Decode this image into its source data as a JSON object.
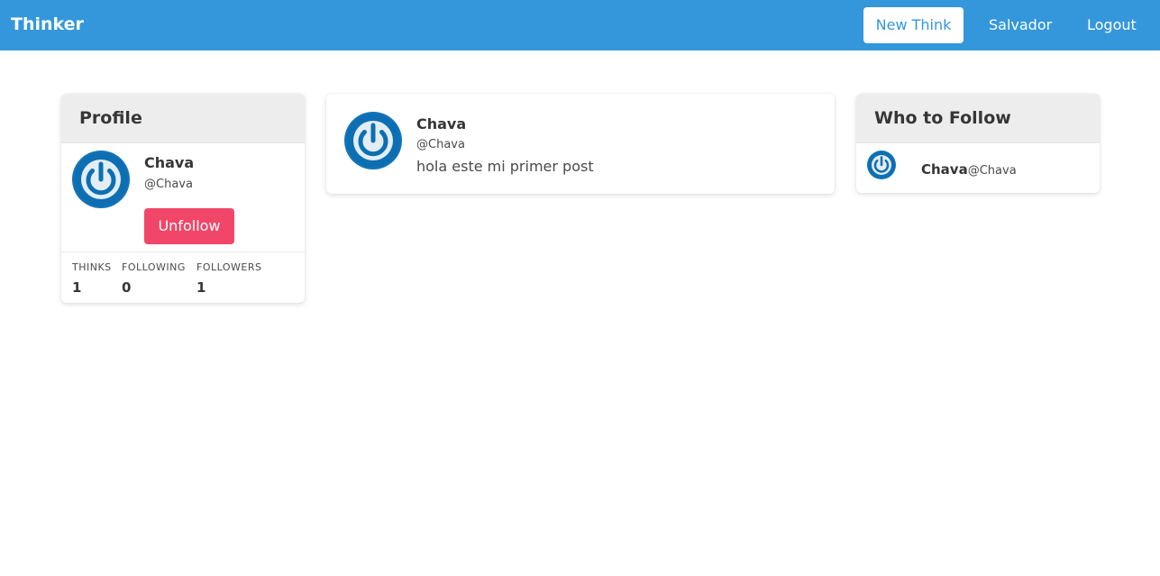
{
  "navbar": {
    "brand": "Thinker",
    "new_think_label": "New Think",
    "user_label": "Salvador",
    "logout_label": "Logout",
    "color": "#3497db"
  },
  "profile": {
    "title": "Profile",
    "name": "Chava",
    "handle": "@Chava",
    "unfollow_label": "Unfollow",
    "avatar_icon": "power-icon",
    "stats": {
      "thinks_label": "THINKS",
      "thinks_value": "1",
      "following_label": "FOLLOWING",
      "following_value": "0",
      "followers_label": "FOLLOWERS",
      "followers_value": "1"
    }
  },
  "feed": {
    "posts": [
      {
        "name": "Chava",
        "handle": "@Chava",
        "content": "hola este mi primer post",
        "avatar_icon": "power-icon"
      }
    ]
  },
  "who_to_follow": {
    "title": "Who to Follow",
    "items": [
      {
        "name": "Chava",
        "handle": "@Chava",
        "avatar_icon": "power-icon"
      }
    ]
  },
  "colors": {
    "accent": "#3497db",
    "danger": "#f14668",
    "card_header": "#ededed"
  }
}
